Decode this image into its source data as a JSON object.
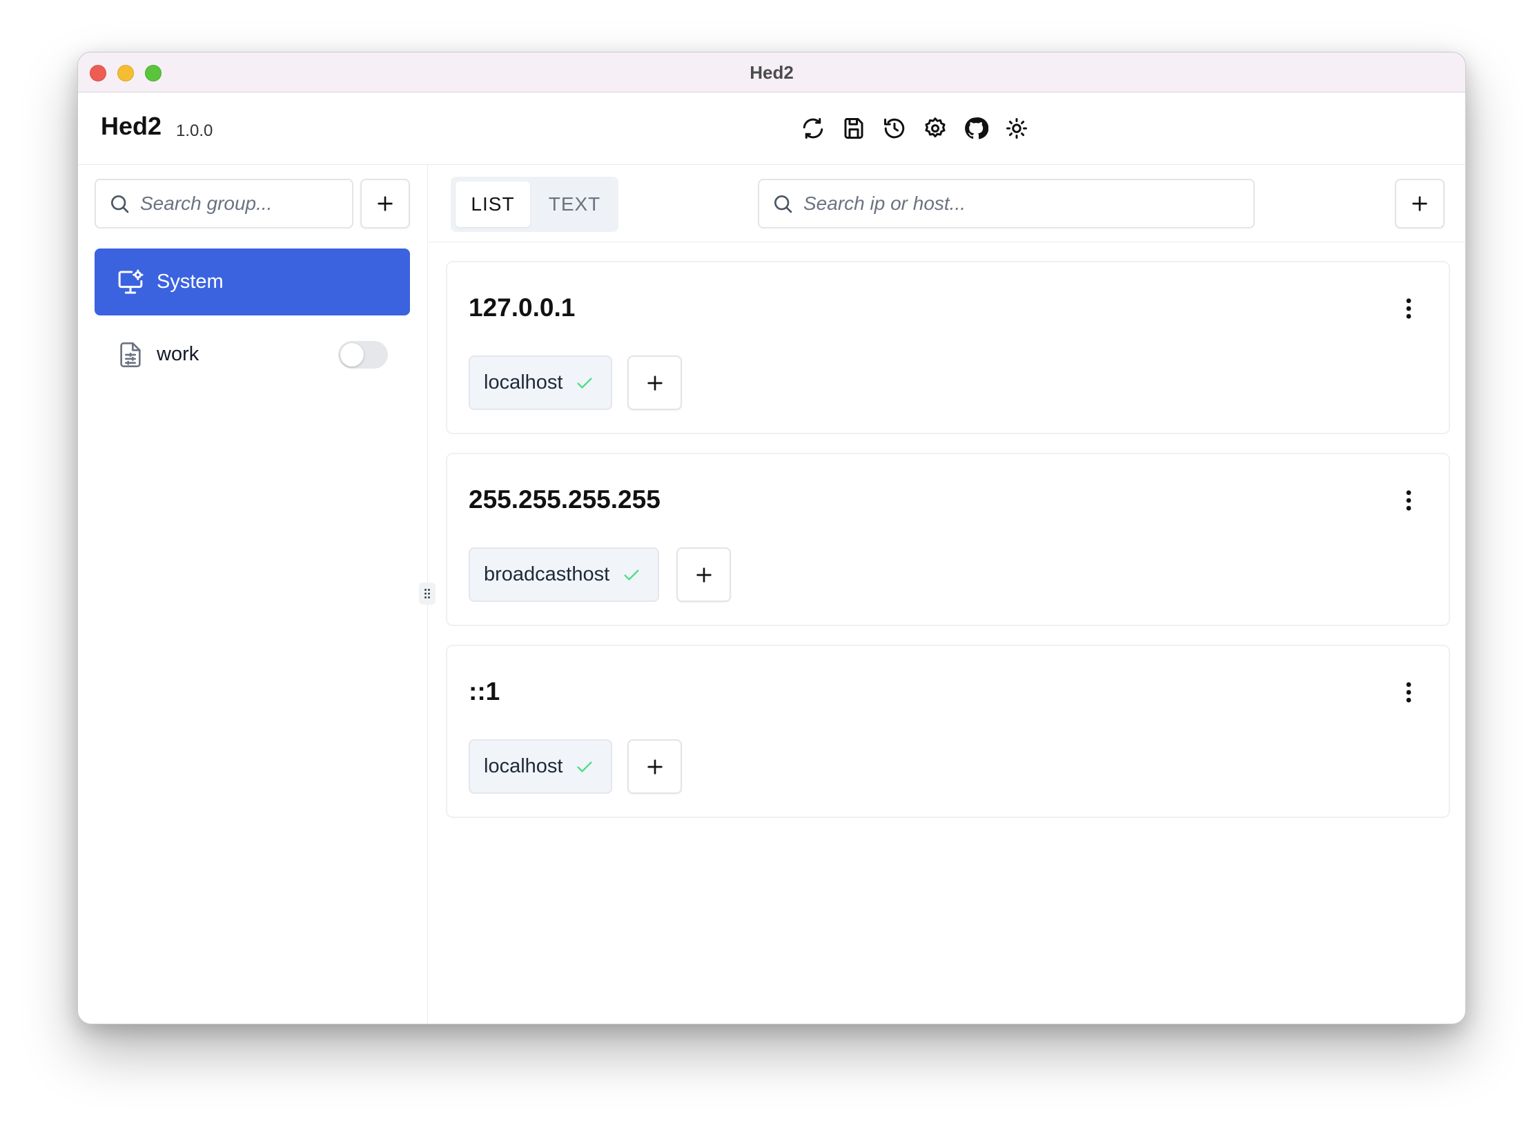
{
  "window": {
    "title": "Hed2"
  },
  "header": {
    "app_name": "Hed2",
    "version": "1.0.0",
    "actions": [
      {
        "icon": "refresh-icon"
      },
      {
        "icon": "save-icon"
      },
      {
        "icon": "history-icon"
      },
      {
        "icon": "settings-icon"
      },
      {
        "icon": "github-icon"
      },
      {
        "icon": "theme-sun-icon"
      }
    ]
  },
  "sidebar": {
    "search": {
      "placeholder": "Search group...",
      "value": ""
    },
    "groups": [
      {
        "label": "System",
        "icon": "monitor-cog-icon",
        "active": true
      },
      {
        "label": "work",
        "icon": "file-settings-icon",
        "active": false,
        "enabled": false
      }
    ]
  },
  "main": {
    "tabs": [
      {
        "label": "LIST",
        "active": true
      },
      {
        "label": "TEXT",
        "active": false
      }
    ],
    "search": {
      "placeholder": "Search ip or host...",
      "value": ""
    },
    "entries": [
      {
        "ip": "127.0.0.1",
        "hosts": [
          {
            "name": "localhost",
            "enabled": true
          }
        ]
      },
      {
        "ip": "255.255.255.255",
        "hosts": [
          {
            "name": "broadcasthost",
            "enabled": true
          }
        ]
      },
      {
        "ip": "::1",
        "hosts": [
          {
            "name": "localhost",
            "enabled": true
          }
        ]
      }
    ]
  },
  "colors": {
    "accent": "#3b63e0",
    "check": "#4ade80",
    "border": "#e2e4e8"
  }
}
